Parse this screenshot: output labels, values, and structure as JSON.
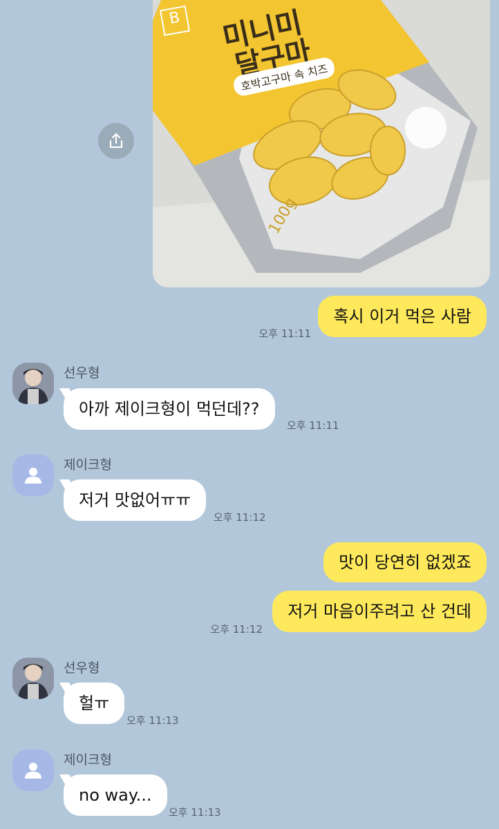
{
  "product": {
    "brand": "B",
    "title_line1": "미니미",
    "title_line2": "달구마",
    "subtitle": "호박고구마 속 치즈",
    "weight": "100g"
  },
  "messages": [
    {
      "sender": "me",
      "text": "혹시 이거 먹은 사람",
      "time": "오후 11:11"
    },
    {
      "sender": "선우형",
      "text": "아까 제이크형이 먹던데??",
      "time": "오후 11:11"
    },
    {
      "sender": "제이크형",
      "text": "저거 맛없어ㅠㅠ",
      "time": "오후 11:12"
    },
    {
      "sender": "me",
      "text": "맛이 당연히 없겠죠",
      "time": ""
    },
    {
      "sender": "me",
      "text": "저거 마음이주려고 산 건데",
      "time": "오후 11:12"
    },
    {
      "sender": "선우형",
      "text": "헐ㅠ",
      "time": "오후 11:13"
    },
    {
      "sender": "제이크형",
      "text": "no way...",
      "time": "오후 11:13"
    }
  ],
  "senders": {
    "sunwoo": "선우형",
    "jake": "제이크형"
  },
  "colors": {
    "background": "#b2c7d9",
    "my_bubble": "#fee95c",
    "their_bubble": "#ffffff",
    "default_avatar": "#a6b8e6"
  },
  "icons": {
    "share": "share-icon",
    "default_avatar": "person-icon"
  }
}
